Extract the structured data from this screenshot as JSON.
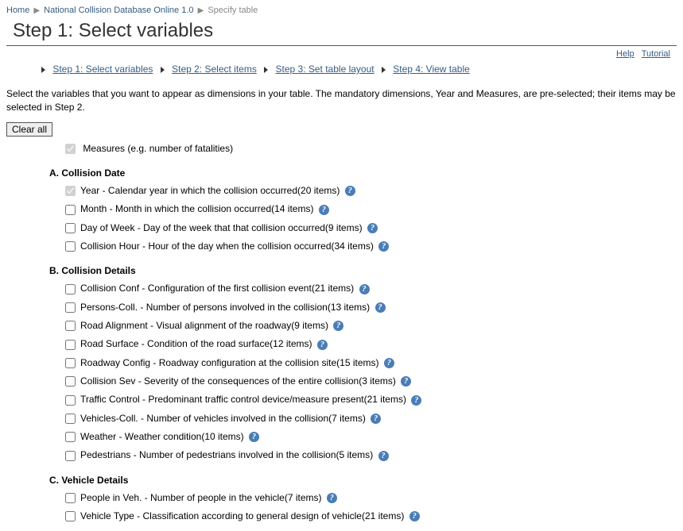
{
  "breadcrumb": {
    "home": "Home",
    "db": "National Collision Database Online 1.0",
    "current": "Specify table"
  },
  "page_title": "Step 1: Select variables",
  "top_links": {
    "help": "Help",
    "tutorial": "Tutorial"
  },
  "wizard": {
    "s1": "Step 1: Select variables",
    "s2": "Step 2: Select items",
    "s3": "Step 3: Set table layout",
    "s4": "Step 4: View table"
  },
  "instruction": "Select the variables that you want to appear as dimensions in your table. The mandatory dimensions, Year and Measures, are pre-selected; their items may be selected in Step 2.",
  "clear_all_label": "Clear all",
  "measures_label": "Measures (e.g. number of fatalities)",
  "sections": {
    "a": {
      "head": "A. Collision Date",
      "items": [
        {
          "label": "Year - Calendar year in which the collision occurred",
          "count": "20 items",
          "locked": true
        },
        {
          "label": "Month - Month in which the collision occurred",
          "count": "14 items"
        },
        {
          "label": "Day of Week - Day of the week that that collision occurred",
          "count": "9 items"
        },
        {
          "label": "Collision Hour - Hour of the day when the collision occurred",
          "count": "34 items"
        }
      ]
    },
    "b": {
      "head": "B. Collision Details",
      "items": [
        {
          "label": "Collision Conf - Configuration of the first collision event",
          "count": "21 items"
        },
        {
          "label": "Persons-Coll. - Number of persons involved in the collision",
          "count": "13 items"
        },
        {
          "label": "Road Alignment - Visual alignment of the roadway",
          "count": "9 items"
        },
        {
          "label": "Road Surface - Condition of the road surface",
          "count": "12 items"
        },
        {
          "label": "Roadway Config - Roadway configuration at the collision site",
          "count": "15 items"
        },
        {
          "label": "Collision Sev - Severity of the consequences of the entire collision",
          "count": "3 items"
        },
        {
          "label": "Traffic Control - Predominant traffic control device/measure present",
          "count": "21 items"
        },
        {
          "label": "Vehicles-Coll. - Number of vehicles involved in the collision",
          "count": "7 items"
        },
        {
          "label": "Weather - Weather condition",
          "count": "10 items"
        },
        {
          "label": "Pedestrians - Number of pedestrians involved in the collision",
          "count": "5 items"
        }
      ]
    },
    "c": {
      "head": "C. Vehicle Details",
      "items": [
        {
          "label": "People in Veh. - Number of people in the vehicle",
          "count": "7 items"
        },
        {
          "label": "Vehicle Type - Classification according to general design of vehicle",
          "count": "21 items"
        }
      ]
    }
  }
}
